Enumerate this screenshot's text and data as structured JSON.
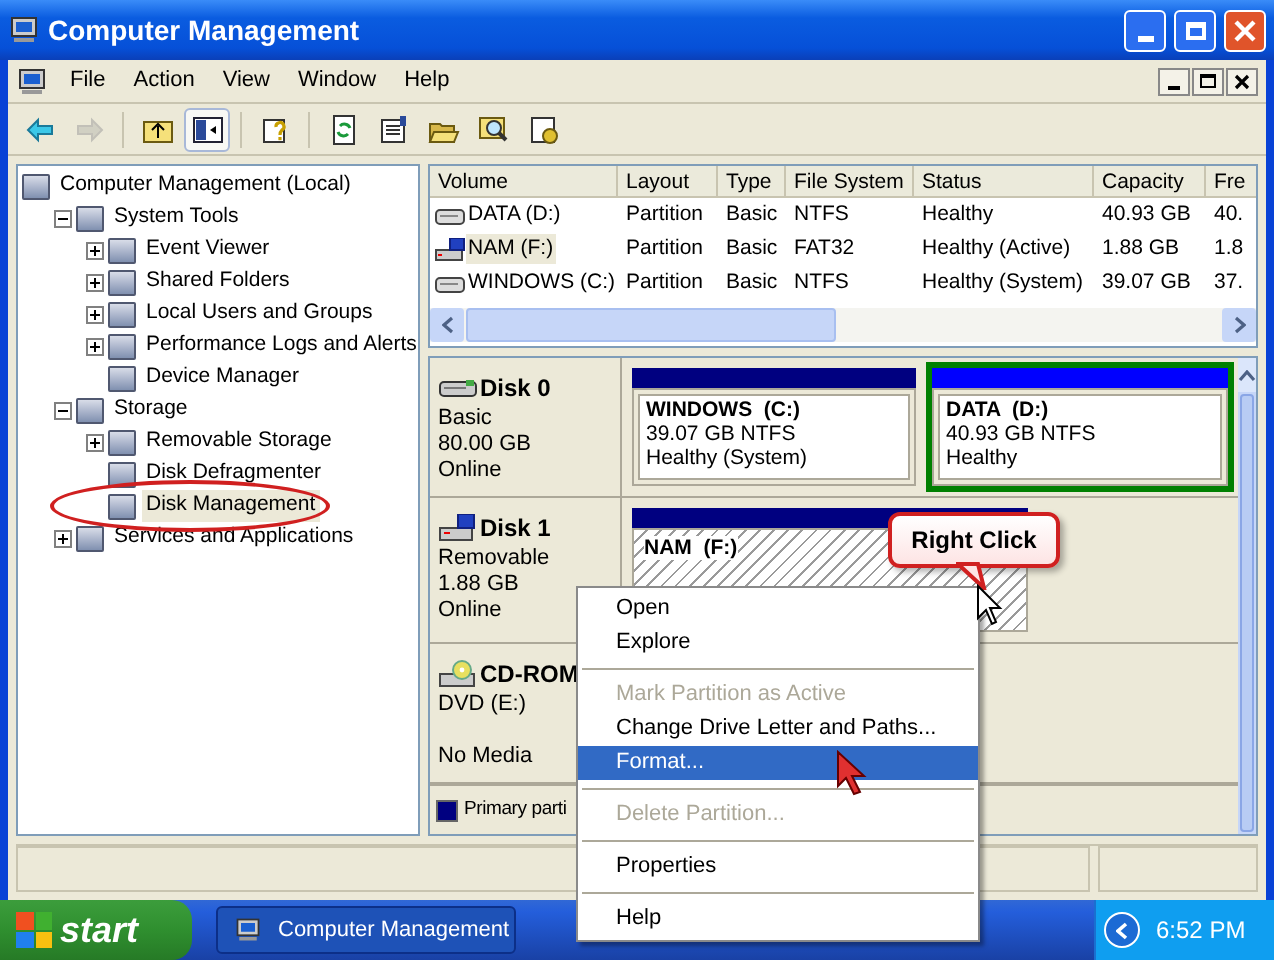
{
  "window": {
    "title": "Computer Management"
  },
  "menu": [
    "File",
    "Action",
    "View",
    "Window",
    "Help"
  ],
  "toolbar": [
    {
      "kind": "back",
      "disabled": false,
      "pressed": false
    },
    {
      "kind": "forward",
      "disabled": true,
      "pressed": false
    },
    {
      "kind": "up",
      "disabled": false,
      "pressed": false
    },
    {
      "kind": "tree",
      "disabled": false,
      "pressed": true
    },
    {
      "kind": "help",
      "disabled": false,
      "pressed": false
    },
    {
      "kind": "refresh",
      "disabled": false,
      "pressed": false
    },
    {
      "kind": "properties",
      "disabled": false,
      "pressed": false
    },
    {
      "kind": "open",
      "disabled": false,
      "pressed": false
    },
    {
      "kind": "search",
      "disabled": false,
      "pressed": false
    },
    {
      "kind": "settings",
      "disabled": false,
      "pressed": false
    }
  ],
  "tree": [
    {
      "label": "Computer Management (Local)",
      "selected": false,
      "children": [
        {
          "label": "System Tools",
          "expanded": true,
          "selected": false,
          "children": [
            {
              "label": "Event Viewer",
              "expanded": false,
              "selected": false
            },
            {
              "label": "Shared Folders",
              "expanded": false,
              "selected": false
            },
            {
              "label": "Local Users and Groups",
              "expanded": false,
              "selected": false
            },
            {
              "label": "Performance Logs and Alerts",
              "expanded": false,
              "selected": false
            },
            {
              "label": "Device Manager",
              "selected": false
            }
          ]
        },
        {
          "label": "Storage",
          "expanded": true,
          "selected": false,
          "children": [
            {
              "label": "Removable Storage",
              "expanded": false,
              "selected": false
            },
            {
              "label": "Disk Defragmenter",
              "selected": false
            },
            {
              "label": "Disk Management",
              "selected": true,
              "circled": true
            }
          ]
        },
        {
          "label": "Services and Applications",
          "expanded": false,
          "selected": false
        }
      ]
    }
  ],
  "volumes": {
    "columns": [
      "Volume",
      "Layout",
      "Type",
      "File System",
      "Status",
      "Capacity",
      "Fre"
    ],
    "rows": [
      {
        "kind": "fixed",
        "selected": false,
        "cells": [
          "DATA (D:)",
          "Partition",
          "Basic",
          "NTFS",
          "Healthy",
          "40.93 GB",
          "40."
        ]
      },
      {
        "kind": "removable",
        "selected": true,
        "cells": [
          "NAM (F:)",
          "Partition",
          "Basic",
          "FAT32",
          "Healthy (Active)",
          "1.88 GB",
          "1.8"
        ]
      },
      {
        "kind": "fixed",
        "selected": false,
        "cells": [
          "WINDOWS (C:)",
          "Partition",
          "Basic",
          "NTFS",
          "Healthy (System)",
          "39.07 GB",
          "37."
        ]
      }
    ]
  },
  "disks": [
    {
      "kind": "fixed",
      "name": "Disk 0",
      "lines": [
        "Basic",
        "80.00 GB",
        "Online"
      ],
      "partitions": [
        {
          "name": "WINDOWS  (C:)",
          "size": "39.07 GB NTFS",
          "status": "Healthy (System)",
          "color": "#000080",
          "selected": false,
          "outlined": false
        },
        {
          "name": "DATA  (D:)",
          "size": "40.93 GB NTFS",
          "status": "Healthy",
          "color": "#0000ff",
          "selected": false,
          "outlined": true
        }
      ]
    },
    {
      "kind": "removable",
      "name": "Disk 1",
      "lines": [
        "Removable",
        "1.88 GB",
        "Online"
      ],
      "partitions": [
        {
          "name": "NAM  (F:)",
          "color": "#000080",
          "selected": true,
          "outlined": false
        }
      ]
    },
    {
      "kind": "cdrom",
      "name": "CD-ROM",
      "lines": [
        "DVD (E:)",
        "No Media"
      ]
    }
  ],
  "legend": [
    {
      "label": "Primary parti",
      "color": "#000080"
    }
  ],
  "context_menu": [
    {
      "kind": "item",
      "label": "Open",
      "disabled": false,
      "selected": false
    },
    {
      "kind": "item",
      "label": "Explore",
      "disabled": false,
      "selected": false
    },
    {
      "kind": "separator"
    },
    {
      "kind": "item",
      "label": "Mark Partition as Active",
      "disabled": true,
      "selected": false
    },
    {
      "kind": "item",
      "label": "Change Drive Letter and Paths...",
      "disabled": false,
      "selected": false
    },
    {
      "kind": "item",
      "label": "Format...",
      "disabled": false,
      "selected": true
    },
    {
      "kind": "separator"
    },
    {
      "kind": "item",
      "label": "Delete Partition...",
      "disabled": true,
      "selected": false
    },
    {
      "kind": "separator"
    },
    {
      "kind": "item",
      "label": "Properties",
      "disabled": false,
      "selected": false
    },
    {
      "kind": "separator"
    },
    {
      "kind": "item",
      "label": "Help",
      "disabled": false,
      "selected": false
    }
  ],
  "callout": {
    "text": "Right Click"
  },
  "taskbar": {
    "start": "start",
    "tasks": [
      {
        "label": "Computer Management",
        "selected": true
      }
    ],
    "clock": "6:52 PM"
  }
}
